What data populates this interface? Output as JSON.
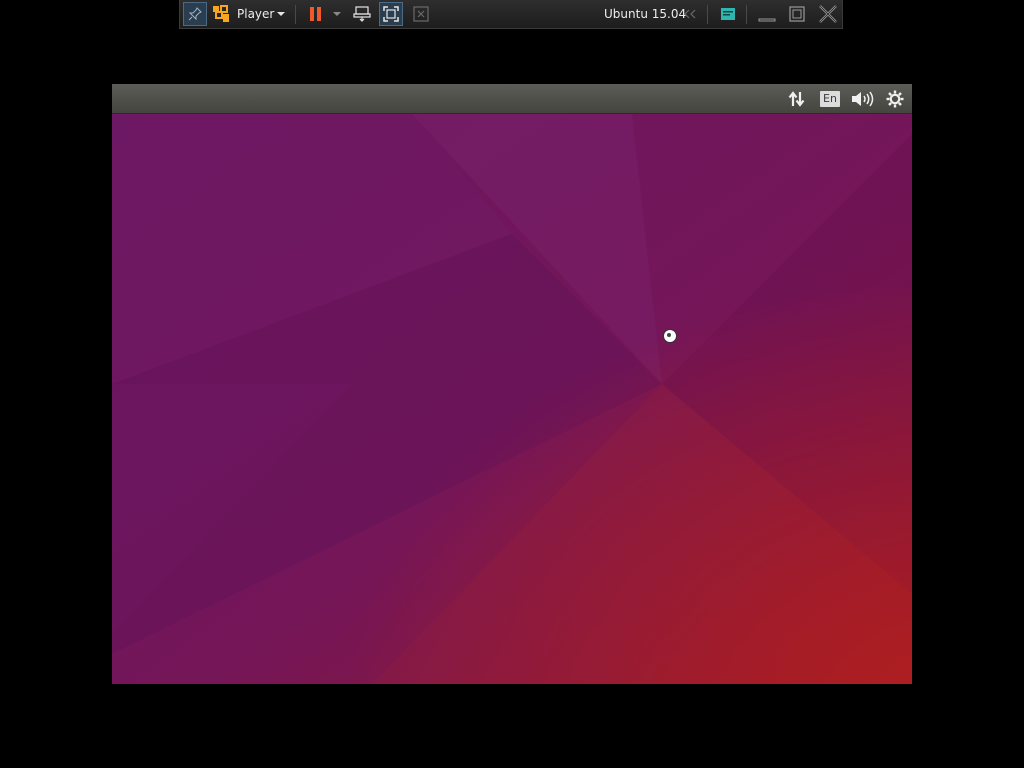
{
  "player_toolbar": {
    "menu_label": "Player",
    "vm_name": "Ubuntu 15.04",
    "icons": [
      "pin-icon",
      "player-logo-icon",
      "chevron-down-icon",
      "pause-icon",
      "chevron-down-icon",
      "send-ctrl-alt-del-icon",
      "fullscreen-icon",
      "unity-icon",
      "double-chevron-left-icon",
      "library-icon",
      "minimize-icon",
      "restore-icon",
      "close-icon"
    ],
    "colors": {
      "pause_accent": "#f05a28",
      "library_accent": "#2fb6b0"
    }
  },
  "guest": {
    "panel": {
      "keyboard_layout": "En",
      "icons": [
        "network-icon",
        "keyboard-layout-icon",
        "volume-icon",
        "gear-icon"
      ]
    },
    "desktop": {
      "wallpaper_colors": [
        "#6a1660",
        "#8a1a48",
        "#9c1c24"
      ],
      "cursor": "busy-cursor-icon"
    }
  }
}
